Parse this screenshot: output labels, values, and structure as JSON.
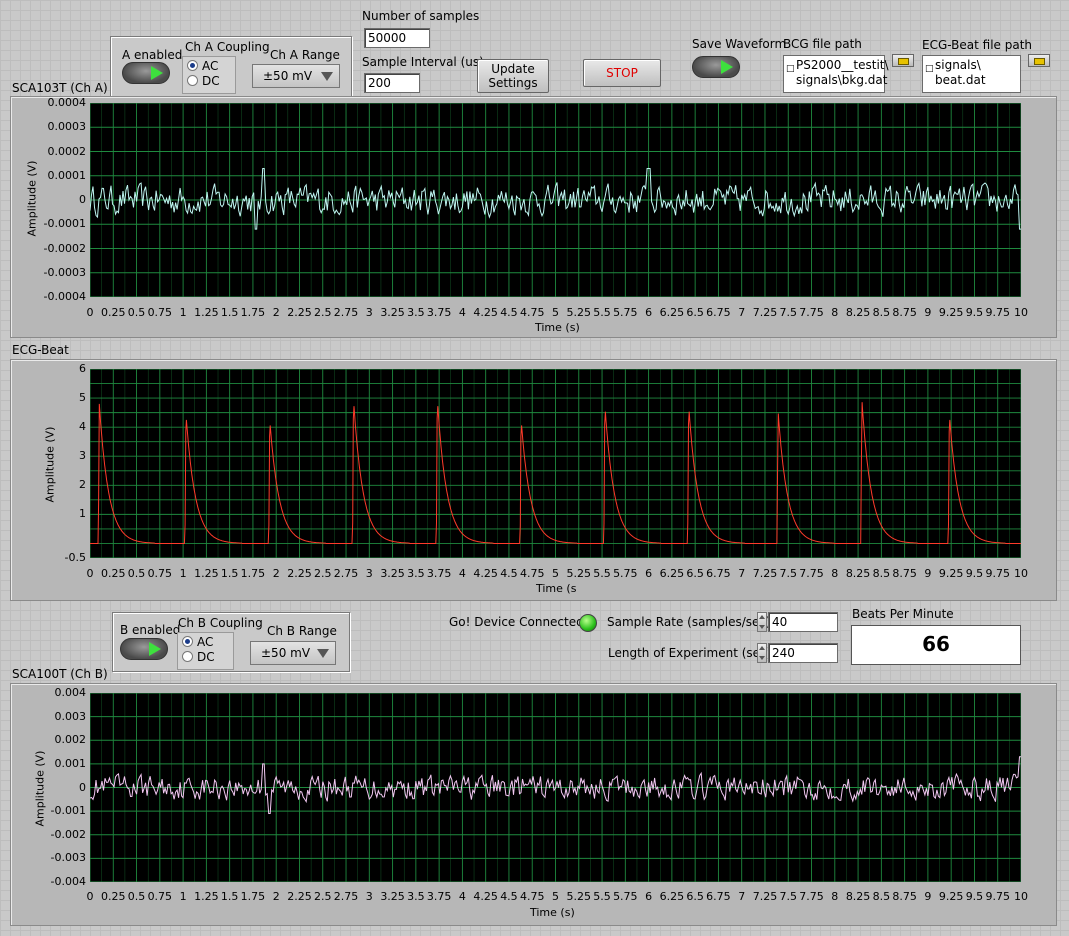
{
  "top": {
    "a_enabled_label": "A enabled",
    "ch_a_coupling_label": "Ch A Coupling",
    "coupling_options": [
      "AC",
      "DC"
    ],
    "ch_a_coupling_selected": "AC",
    "ch_a_range_label": "Ch A Range",
    "ch_a_range_value": "±50 mV",
    "num_samples_label": "Number of samples",
    "num_samples_value": "50000",
    "sample_interval_label": "Sample Interval (us)",
    "sample_interval_value": "200",
    "update_settings_label_1": "Update",
    "update_settings_label_2": "Settings",
    "stop_label": "STOP",
    "save_waveform_label": "Save Waveform",
    "bcg_path_label": "BCG file path",
    "bcg_path_line1": "PS2000__testit\\",
    "bcg_path_line2": "signals\\bkg.dat",
    "ecg_path_label": "ECG-Beat file path",
    "ecg_path_line1": "signals\\",
    "ecg_path_line2": "beat.dat"
  },
  "middle": {
    "b_enabled_label": "B enabled",
    "ch_b_coupling_label": "Ch B Coupling",
    "ch_b_coupling_selected": "AC",
    "ch_b_range_label": "Ch B Range",
    "ch_b_range_value": "±50 mV",
    "device_connected_label": "Go! Device Connected?",
    "sample_rate_label": "Sample Rate (samples/sec)",
    "sample_rate_value": "40",
    "length_label": "Length of Experiment (sec)",
    "length_value": "240",
    "bpm_label": "Beats Per Minute",
    "bpm_value": "66"
  },
  "colors": {
    "plot_bg": "#000000",
    "grid": "#1f8a3f",
    "trace_a": "#bff6f2",
    "trace_ecg": "#ff3a2a",
    "trace_b": "#f2c8f2",
    "stop_text": "#e00000",
    "led_green": "#3ee03e"
  },
  "x_ticks": [
    "0",
    "0.25",
    "0.5",
    "0.75",
    "1",
    "1.25",
    "1.5",
    "1.75",
    "2",
    "2.25",
    "2.5",
    "2.75",
    "3",
    "3.25",
    "3.5",
    "3.75",
    "4",
    "4.25",
    "4.5",
    "4.75",
    "5",
    "5.25",
    "5.5",
    "5.75",
    "6",
    "6.25",
    "6.5",
    "6.75",
    "7",
    "7.25",
    "7.5",
    "7.75",
    "8",
    "8.25",
    "8.5",
    "8.75",
    "9",
    "9.25",
    "9.5",
    "9.75",
    "10"
  ],
  "chart_data": [
    {
      "type": "line",
      "title": "SCA103T (Ch A)",
      "xlabel": "Time (s)",
      "ylabel": "Amplitude (V)",
      "xlim": [
        0,
        10
      ],
      "ylim": [
        -0.0004,
        0.0004
      ],
      "yticks": [
        "0.0004",
        "0.0003",
        "0.0002",
        "0.0001",
        "0",
        "-0.0001",
        "-0.0002",
        "-0.0003",
        "-0.0004"
      ],
      "grid": true,
      "series": [
        {
          "amplitude": 6e-05,
          "peaks": [
            [
              1.86,
              0.00013
            ],
            [
              6.0,
              0.00013
            ],
            [
              10.0,
              0.00015
            ],
            [
              1.78,
              -0.00012
            ],
            [
              10.0,
              -0.00012
            ]
          ]
        }
      ]
    },
    {
      "type": "line",
      "title": "ECG-Beat",
      "xlabel": "Time (s",
      "ylabel": "Amplitude (V)",
      "xlim": [
        0,
        10
      ],
      "ylim": [
        -0.5,
        6
      ],
      "yticks": [
        "6",
        "5",
        "4",
        "3",
        "2",
        "1",
        "",
        "-0.5"
      ],
      "grid": true,
      "baseline": 0,
      "beats": [
        {
          "t": 0.1,
          "peak": 4.8
        },
        {
          "t": 1.03,
          "peak": 4.5
        },
        {
          "t": 1.93,
          "peak": 4.3
        },
        {
          "t": 2.83,
          "peak": 5.0
        },
        {
          "t": 3.73,
          "peak": 5.0
        },
        {
          "t": 4.63,
          "peak": 4.3
        },
        {
          "t": 5.53,
          "peak": 4.8
        },
        {
          "t": 6.43,
          "peak": 4.8
        },
        {
          "t": 7.39,
          "peak": 4.6
        },
        {
          "t": 8.29,
          "peak": 5.0
        },
        {
          "t": 9.23,
          "peak": 4.5
        }
      ]
    },
    {
      "type": "line",
      "title": "SCA100T (Ch B)",
      "xlabel": "Time (s)",
      "ylabel": "Amplitude (V)",
      "xlim": [
        0,
        10
      ],
      "ylim": [
        -0.004,
        0.004
      ],
      "yticks": [
        "0.004",
        "0.003",
        "0.002",
        "0.001",
        "0",
        "-0.001",
        "-0.002",
        "-0.003",
        "-0.004"
      ],
      "grid": true,
      "series": [
        {
          "amplitude": 0.0005,
          "peaks": [
            [
              1.86,
              0.001
            ],
            [
              10.0,
              0.0013
            ],
            [
              1.93,
              -0.0011
            ]
          ]
        }
      ]
    }
  ]
}
